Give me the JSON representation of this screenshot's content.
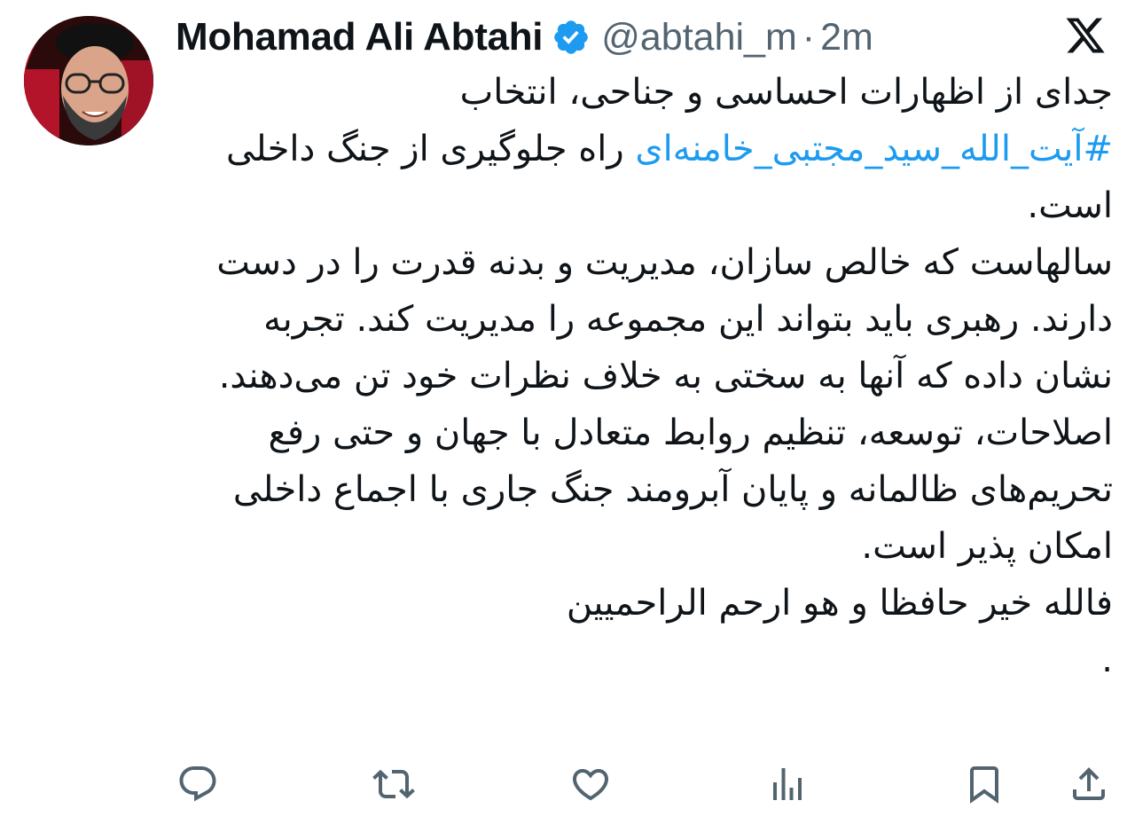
{
  "author": {
    "name": "Mohamad Ali Abtahi",
    "handle": "@abtahi_m",
    "separator": "·",
    "time": "2m",
    "verified": true
  },
  "tweet": {
    "line1": "جدای از اظهارات احساسی و جناحی، انتخاب",
    "hashtag": "#آیت_الله_سید_مجتبی_خامنه‌ای",
    "after_hashtag": " راه جلوگیری از جنگ داخلی است.",
    "paragraph2": "سالهاست که خالص سازان، مدیریت و بدنه قدرت را در دست دارند. رهبری باید بتواند این مجموعه را مدیریت کند. تجربه نشان داده که آنها به سختی به خلاف نظرات خود تن می‌دهند.",
    "paragraph3": "اصلاحات، توسعه، تنظیم روابط متعادل با جهان و حتی رفع تحریم‌های ظالمانه و پایان آبرومند جنگ جاری  با اجماع داخلی امکان پذیر است.",
    "paragraph4": "فالله خیر حافظا و هو ارحم الراحمیین",
    "trailing": "."
  },
  "colors": {
    "text": "#0f1419",
    "muted": "#536471",
    "link": "#1d9bf0",
    "verified_badge": "#1d9bf0"
  },
  "icons": {
    "reply": "reply-icon",
    "retweet": "retweet-icon",
    "like": "heart-icon",
    "views": "views-icon",
    "bookmark": "bookmark-icon",
    "share": "share-icon",
    "logo": "x-logo-icon"
  }
}
